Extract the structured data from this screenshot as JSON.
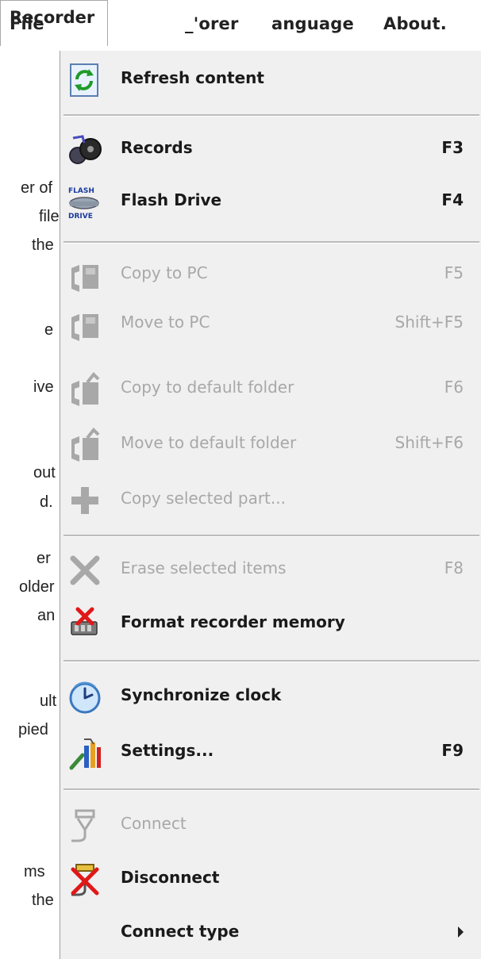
{
  "menubar": {
    "items": [
      "File",
      "Recorder",
      "_'orer",
      "anguage",
      "About."
    ]
  },
  "background_text": [
    "er of",
    "file",
    "the",
    "e",
    "ive",
    "out",
    "d.",
    "er",
    "older",
    "an",
    "ult",
    "pied",
    "ms",
    "the"
  ],
  "menu": {
    "items": [
      {
        "label": "Refresh content",
        "shortcut": "",
        "icon": "refresh-icon",
        "enabled": true
      },
      {
        "label": "Records",
        "shortcut": "F3",
        "icon": "records-icon",
        "enabled": true
      },
      {
        "label": "Flash Drive",
        "shortcut": "F4",
        "icon": "flash-drive-icon",
        "enabled": true
      },
      {
        "label": "Copy to PC",
        "shortcut": "F5",
        "icon": "copy-to-pc-icon",
        "enabled": false
      },
      {
        "label": "Move to PC",
        "shortcut": "Shift+F5",
        "icon": "move-to-pc-icon",
        "enabled": false
      },
      {
        "label": "Copy to default folder",
        "shortcut": "F6",
        "icon": "copy-default-folder-icon",
        "enabled": false
      },
      {
        "label": "Move to default folder",
        "shortcut": "Shift+F6",
        "icon": "move-default-folder-icon",
        "enabled": false
      },
      {
        "label": "Copy selected part...",
        "shortcut": "",
        "icon": "copy-part-icon",
        "enabled": false
      },
      {
        "label": "Erase selected items",
        "shortcut": "F8",
        "icon": "erase-icon",
        "enabled": false
      },
      {
        "label": "Format recorder memory",
        "shortcut": "",
        "icon": "format-memory-icon",
        "enabled": true
      },
      {
        "label": "Synchronize clock",
        "shortcut": "",
        "icon": "clock-icon",
        "enabled": true
      },
      {
        "label": "Settings...",
        "shortcut": "F9",
        "icon": "settings-icon",
        "enabled": true
      },
      {
        "label": "Connect",
        "shortcut": "",
        "icon": "connect-icon",
        "enabled": false
      },
      {
        "label": "Disconnect",
        "shortcut": "",
        "icon": "disconnect-icon",
        "enabled": true
      },
      {
        "label": "Connect type",
        "shortcut": "",
        "icon": "",
        "enabled": true
      }
    ]
  }
}
